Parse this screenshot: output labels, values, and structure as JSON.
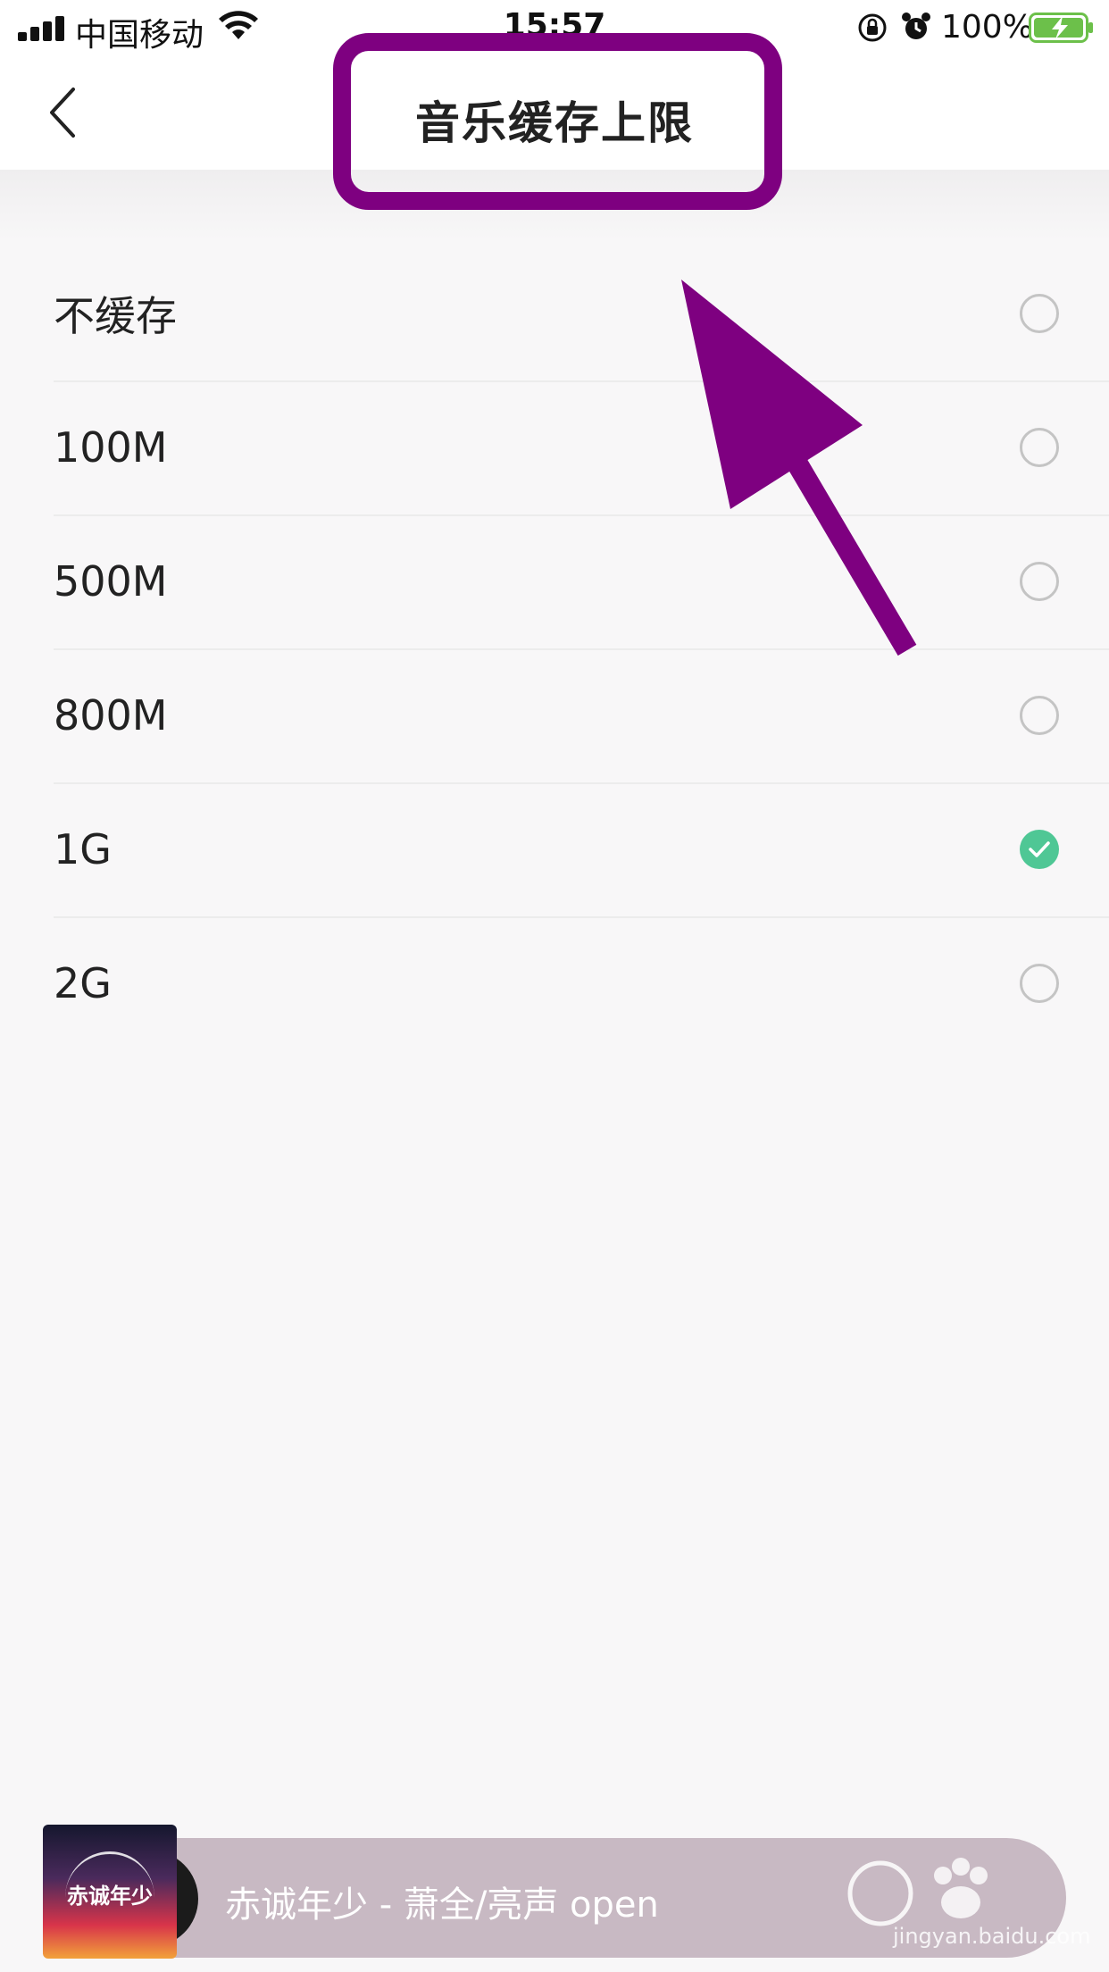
{
  "status_bar": {
    "carrier": "中国移动",
    "time": "15:57",
    "battery_percent": "100%",
    "battery_level": 1.0,
    "icons": [
      "signal-icon",
      "wifi-icon",
      "rotation-lock-icon",
      "alarm-icon",
      "battery-charging-icon"
    ]
  },
  "nav": {
    "title": "音乐缓存上限",
    "back_icon": "chevron-left-icon"
  },
  "options": [
    {
      "label": "不缓存",
      "selected": false
    },
    {
      "label": "100M",
      "selected": false
    },
    {
      "label": "500M",
      "selected": false
    },
    {
      "label": "800M",
      "selected": false
    },
    {
      "label": "1G",
      "selected": true
    },
    {
      "label": "2G",
      "selected": false
    }
  ],
  "player": {
    "album_text": "赤诚年少",
    "song": "赤诚年少 - 萧全/亮声 open"
  },
  "watermark": {
    "text": "jingyan.baidu.com"
  },
  "colors": {
    "accent_selected": "#4fc795",
    "annotation": "#7e0080",
    "player_bg": "#c8b9c3"
  }
}
